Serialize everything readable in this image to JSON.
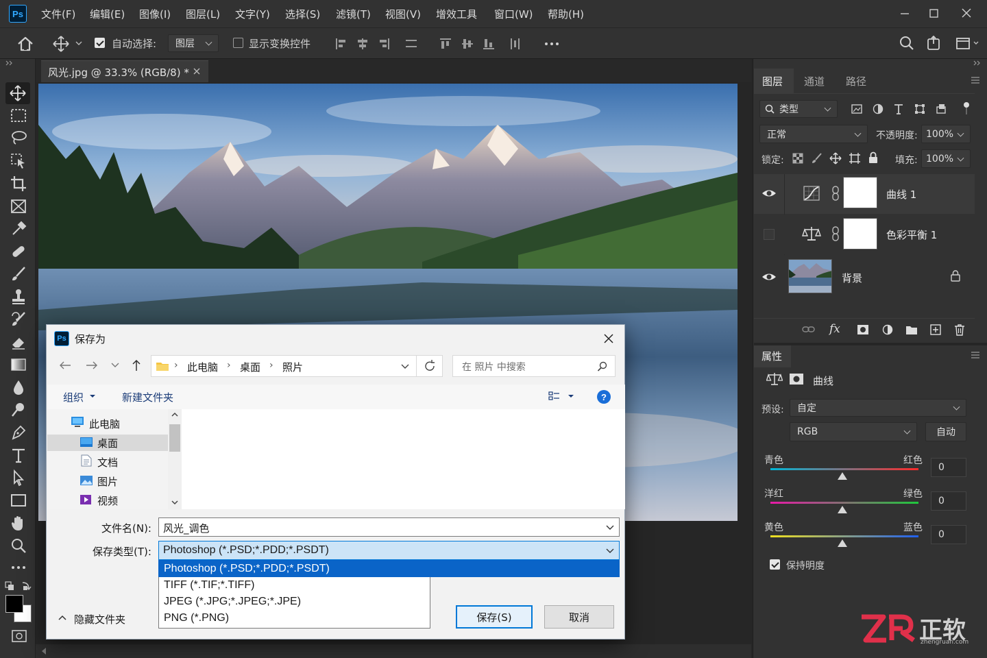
{
  "app": {
    "logo": "Ps"
  },
  "menu": [
    "文件(F)",
    "编辑(E)",
    "图像(I)",
    "图层(L)",
    "文字(Y)",
    "选择(S)",
    "滤镜(T)",
    "视图(V)",
    "增效工具",
    "窗口(W)",
    "帮助(H)"
  ],
  "options": {
    "auto_select_label": "自动选择:",
    "auto_select_checked": true,
    "auto_select_target": "图层",
    "show_transform_label": "显示变换控件",
    "show_transform_checked": false
  },
  "document": {
    "tab_title": "风光.jpg @ 33.3% (RGB/8) *"
  },
  "layers_panel": {
    "tabs": [
      "图层",
      "通道",
      "路径"
    ],
    "filter_kind": "类型",
    "blend_mode": "正常",
    "opacity_label": "不透明度:",
    "opacity": "100%",
    "lock_label": "锁定:",
    "fill_label": "填充:",
    "fill": "100%",
    "layers": [
      {
        "name": "曲线 1",
        "visible": true,
        "type": "curves-adjustment"
      },
      {
        "name": "色彩平衡 1",
        "visible": false,
        "type": "color-balance-adjustment"
      },
      {
        "name": "背景",
        "visible": true,
        "type": "image",
        "locked": true
      }
    ]
  },
  "properties_panel": {
    "title": "属性",
    "adjustment_name": "曲线",
    "preset_label": "预设:",
    "preset": "自定",
    "channel": "RGB",
    "auto_label": "自动",
    "sliders": [
      {
        "left": "青色",
        "right": "红色",
        "value": "0"
      },
      {
        "left": "洋红",
        "right": "绿色",
        "value": "0"
      },
      {
        "left": "黄色",
        "right": "蓝色",
        "value": "0"
      }
    ],
    "preserve_luminosity_label": "保持明度",
    "preserve_luminosity_checked": true
  },
  "dialog": {
    "title": "保存为",
    "breadcrumb": [
      "此电脑",
      "桌面",
      "照片"
    ],
    "search_placeholder": "在 照片 中搜索",
    "organize_label": "组织",
    "new_folder_label": "新建文件夹",
    "help_label": "?",
    "tree": [
      {
        "label": "此电脑",
        "level": 0,
        "icon": "computer-icon"
      },
      {
        "label": "桌面",
        "level": 1,
        "icon": "desktop-icon",
        "selected": true
      },
      {
        "label": "文档",
        "level": 1,
        "icon": "document-icon"
      },
      {
        "label": "图片",
        "level": 1,
        "icon": "pictures-icon"
      },
      {
        "label": "视频",
        "level": 1,
        "icon": "video-icon"
      }
    ],
    "filename_label": "文件名(N):",
    "filename": "风光_调色",
    "filetype_label": "保存类型(T):",
    "filetype": "Photoshop (*.PSD;*.PDD;*.PSDT)",
    "filetype_options": [
      "Photoshop (*.PSD;*.PDD;*.PSDT)",
      "TIFF (*.TIF;*.TIFF)",
      "JPEG (*.JPG;*.JPEG;*.JPE)",
      "PNG (*.PNG)"
    ],
    "hide_folders_label": "隐藏文件夹",
    "save_label": "保存(S)",
    "cancel_label": "取消"
  },
  "watermark": {
    "brand": "正软",
    "site": "zhengruan.com"
  },
  "colors": {
    "ps_accent": "#31a8ff",
    "selection_blue": "#0a64c8",
    "watermark_red": "#e0304a"
  }
}
